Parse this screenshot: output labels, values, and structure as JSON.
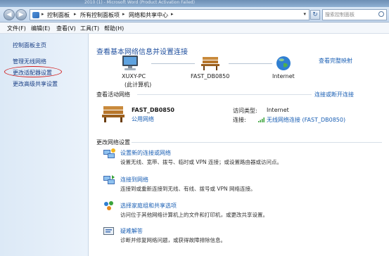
{
  "window": {
    "title": "2010 (1) - Microsoft Word (Product Activation Failed)"
  },
  "address": {
    "crumbs": [
      "控制面板",
      "所有控制面板项",
      "网络和共享中心"
    ],
    "search_placeholder": "搜索控制面板"
  },
  "menu": {
    "items": [
      "文件(F)",
      "编辑(E)",
      "查看(V)",
      "工具(T)",
      "帮助(H)"
    ]
  },
  "sidebar": {
    "items": [
      "控制面板主页",
      "管理无线网络",
      "更改适配器设置",
      "更改高级共享设置"
    ]
  },
  "main": {
    "title": "查看基本网络信息并设置连接",
    "full_map_link": "查看完整映射",
    "nodes": [
      {
        "name": "XUXY-PC",
        "sub": "(此计算机)"
      },
      {
        "name": "FAST_DB0850",
        "sub": ""
      },
      {
        "name": "Internet",
        "sub": ""
      }
    ],
    "active_section": {
      "heading": "查看活动网络",
      "action_link": "连接或断开连接",
      "network_name": "FAST_DB0850",
      "network_type": "公用网络",
      "access_label": "访问类型:",
      "access_value": "Internet",
      "connection_label": "连接:",
      "connection_value": "无线网络连接 (FAST_DB0850)"
    },
    "change_section": {
      "heading": "更改网络设置",
      "tasks": [
        {
          "title": "设置新的连接或网络",
          "desc": "设置无线、宽带、拨号、临时或 VPN 连接；或设置路由器或访问点。"
        },
        {
          "title": "连接到网络",
          "desc": "连接到或重新连接到无线、有线、拨号或 VPN 网络连接。"
        },
        {
          "title": "选择家庭组和共享选项",
          "desc": "访问位于其他网络计算机上的文件和打印机，或更改共享设置。"
        },
        {
          "title": "疑难解答",
          "desc": "诊断并修复网络问题，或获得故障排除信息。"
        }
      ]
    }
  },
  "colors": {
    "link": "#1a5fb4",
    "title": "#1f4f9e",
    "annotation": "#d31f1f",
    "sidebar_top": "#dce9f6"
  }
}
